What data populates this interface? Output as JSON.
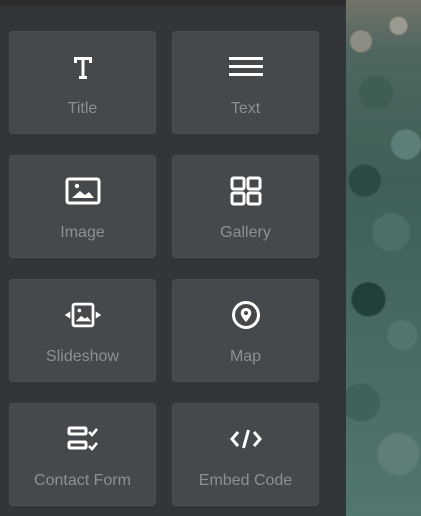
{
  "panel": {
    "tiles": [
      {
        "label": "Title",
        "icon": "title-icon"
      },
      {
        "label": "Text",
        "icon": "text-icon"
      },
      {
        "label": "Image",
        "icon": "image-icon"
      },
      {
        "label": "Gallery",
        "icon": "gallery-icon"
      },
      {
        "label": "Slideshow",
        "icon": "slideshow-icon"
      },
      {
        "label": "Map",
        "icon": "map-pin-icon"
      },
      {
        "label": "Contact Form",
        "icon": "contact-form-icon"
      },
      {
        "label": "Embed Code",
        "icon": "embed-code-icon"
      }
    ]
  },
  "colors": {
    "panel_bg": "#333638",
    "tile_bg": "#46494b",
    "icon_color": "#ffffff",
    "label_color": "#8d8f91"
  }
}
